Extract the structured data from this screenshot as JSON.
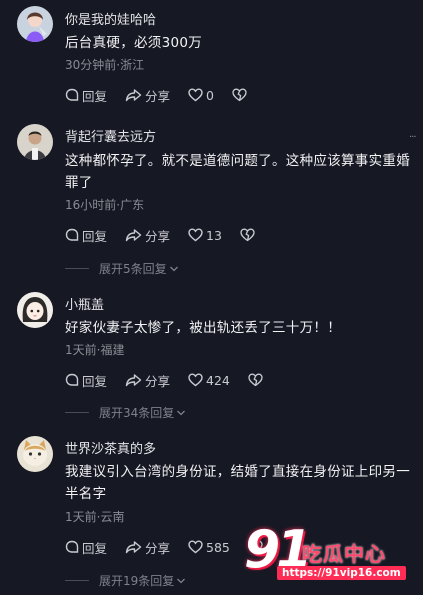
{
  "comments": [
    {
      "username": "你是我的娃哈哈",
      "text": "后台真硬，必须300万",
      "time": "30分钟前",
      "location": "浙江",
      "meta": "30分钟前·浙江",
      "reply_label": "回复",
      "share_label": "分享",
      "likes": "0",
      "avatar_icon": "avatar-girl-anime"
    },
    {
      "username": "背起行囊去远方",
      "text": "这种都怀孕了。就不是道德问题了。这种应该算事实重婚罪了",
      "time": "16小时前",
      "location": "广东",
      "meta": "16小时前·广东",
      "reply_label": "回复",
      "share_label": "分享",
      "likes": "13",
      "expand_label": "展开5条回复",
      "avatar_icon": "avatar-man-photo"
    },
    {
      "username": "小瓶盖",
      "text": "好家伙妻子太惨了，被出轨还丢了三十万！！",
      "time": "1天前",
      "location": "福建",
      "meta": "1天前·福建",
      "reply_label": "回复",
      "share_label": "分享",
      "likes": "424",
      "expand_label": "展开34条回复",
      "avatar_icon": "avatar-girl-cartoon"
    },
    {
      "username": "世界沙茶真的多",
      "text": "我建议引入台湾的身份证，结婚了直接在身份证上印另一半名字",
      "time": "1天前",
      "location": "云南",
      "meta": "1天前·云南",
      "reply_label": "回复",
      "share_label": "分享",
      "likes": "585",
      "expand_label": "展开19条回复",
      "avatar_icon": "avatar-cat"
    }
  ],
  "watermark": {
    "digits": "91",
    "title": "吃瓜中心",
    "url": "https://91vip16.com"
  },
  "colors": {
    "background": "#161823",
    "accent": "#ff2d55"
  }
}
